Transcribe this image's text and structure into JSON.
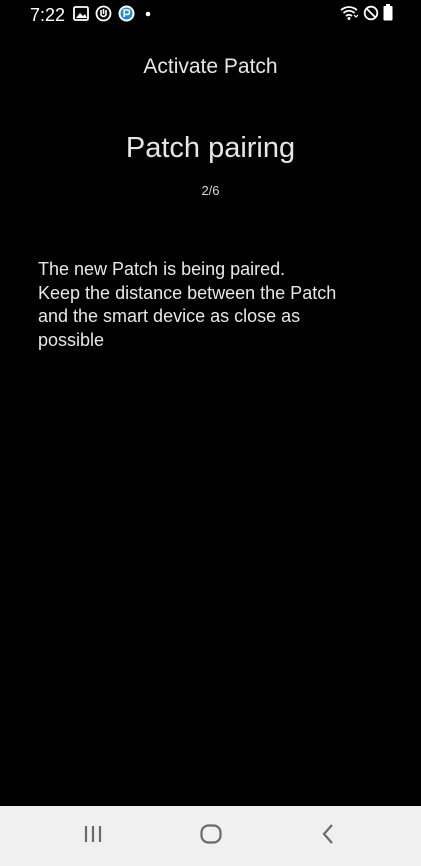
{
  "status_bar": {
    "time": "7:22",
    "left_icons": [
      "gallery-icon",
      "vpn-icon",
      "app-notification-icon",
      "more-notifications-dot-icon"
    ],
    "right_icons": [
      "wifi-icon",
      "do-not-disturb-icon",
      "battery-icon"
    ]
  },
  "header": {
    "title": "Activate Patch"
  },
  "step": {
    "title": "Patch pairing",
    "counter": "2/6"
  },
  "instructions": {
    "line1": "The new Patch is being paired.",
    "line2": "Keep the distance between the Patch",
    "line3": "and the smart device as close as",
    "line4": "possible"
  },
  "nav_bar": {
    "buttons": [
      "recent-apps-icon",
      "home-icon",
      "back-icon"
    ]
  },
  "colors": {
    "background": "#000000",
    "text": "#e8e8e8",
    "nav_bar_background": "#f0f0f0",
    "nav_icon": "#6a6a6a"
  }
}
